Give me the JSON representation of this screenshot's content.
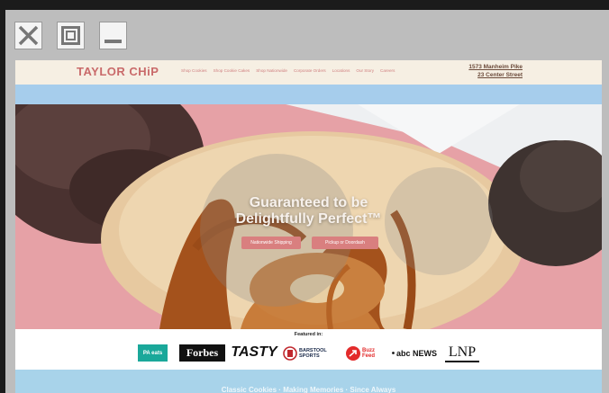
{
  "window_controls": {
    "close_icon": "close-icon",
    "maximize_icon": "maximize-icon",
    "minimize_icon": "minimize-icon"
  },
  "site": {
    "logo": "TAYLOR CHiP",
    "nav": [
      "Shop Cookies",
      "Shop Cookie Cakes",
      "Shop Nationwide",
      "Corporate Orders",
      "Locations",
      "Our Story",
      "Careers"
    ],
    "address_line1": "1573 Manheim Pike",
    "address_line2": "23 Center Street"
  },
  "hero": {
    "headline_line1": "Guaranteed to be",
    "headline_line2": "Delightfully Perfect™",
    "button_shipping": "Nationwide Shipping",
    "button_pickup": "Pickup or Doordash"
  },
  "featured": {
    "label": "Featured in:",
    "logos": [
      "PA eats",
      "Forbes",
      "TASTY",
      "BARSTOOL SPORTS",
      "Buzz Feed",
      "abc NEWS",
      "LNP"
    ]
  },
  "footer": {
    "tagline": "Classic Cookies · Making Memories · Since Always"
  },
  "colors": {
    "topbar": "#f6efe3",
    "accent": "#c96a6a",
    "band": "#a6cdec",
    "hero_pink": "#e9a3a8"
  }
}
